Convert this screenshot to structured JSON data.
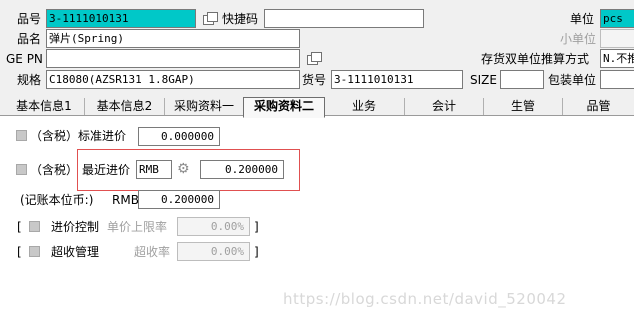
{
  "header": {
    "product_code_label": "品号",
    "product_code_value": "3-1111010131",
    "quick_code_label": "快捷码",
    "quick_code_value": "",
    "unit_label": "单位",
    "unit_value": "pcs",
    "small_unit_label": "小单位",
    "small_unit_value": "",
    "product_name_label": "品名",
    "product_name_value": "弹片(Spring)",
    "ge_pn_label": "GE PN",
    "ge_pn_value": "",
    "dual_unit_label": "存货双单位推算方式",
    "dual_unit_value": "N.不推",
    "spec_label": "规格",
    "spec_value": "C18080(AZSR131 1.8GAP)",
    "goods_no_label": "货号",
    "goods_no_value": "3-1111010131",
    "size_label": "SIZE",
    "size_value": "",
    "pack_unit_label": "包装单位",
    "pack_unit_value": ""
  },
  "tabs": [
    {
      "label": "基本信息1"
    },
    {
      "label": "基本信息2"
    },
    {
      "label": "采购资料一"
    },
    {
      "label": "采购资料二"
    },
    {
      "label": "业务"
    },
    {
      "label": "会计"
    },
    {
      "label": "生管"
    },
    {
      "label": "品管"
    }
  ],
  "content": {
    "std_price_label": "（含税）标准进价",
    "std_price_value": "0.000000",
    "tax_label": "（含税）",
    "recent_price_label": "最近进价",
    "currency_value": "RMB",
    "recent_price_value": "0.200000",
    "base_currency_label": "(记账本位币:)",
    "base_currency_code": "RMB",
    "base_currency_value": "0.200000",
    "price_control_open": "[",
    "price_control_label": "进价控制",
    "upper_limit_label": "单价上限率",
    "upper_limit_value": "0.00%",
    "price_control_close": "]",
    "over_receive_open": "[",
    "over_receive_label": "超收管理",
    "over_receive_rate_label": "超收率",
    "over_receive_rate_value": "0.00%",
    "over_receive_close": "]"
  },
  "watermark": "https://blog.csdn.net/david_520042"
}
